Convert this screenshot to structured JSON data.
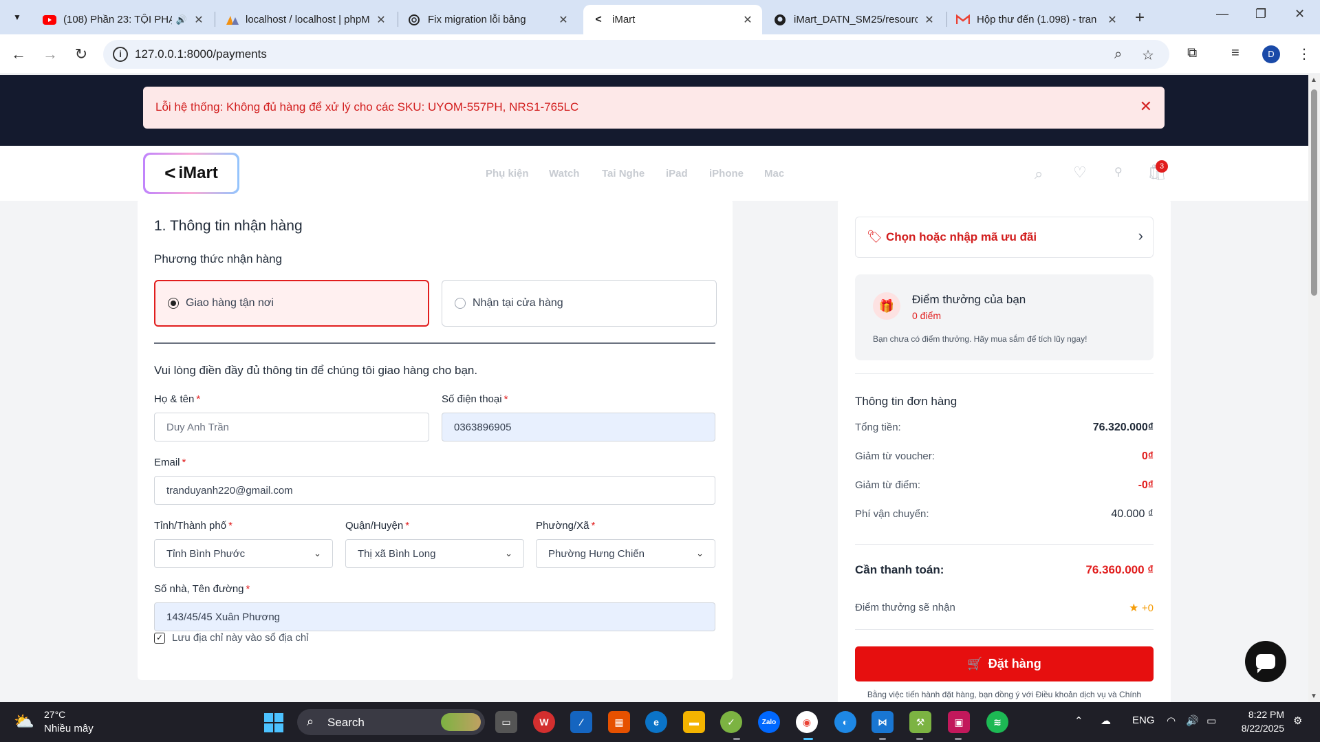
{
  "browser": {
    "tabs": [
      {
        "title": "(108) Phần 23: TỘI PHẠ",
        "icon": "youtube-icon"
      },
      {
        "title": "localhost / localhost | phpM",
        "icon": "phpmyadmin-icon"
      },
      {
        "title": "Fix migration lỗi bảng",
        "icon": "chatgpt-icon"
      },
      {
        "title": "iMart",
        "icon": "imart-icon"
      },
      {
        "title": "iMart_DATN_SM25/resourc",
        "icon": "github-icon"
      },
      {
        "title": "Hộp thư đến (1.098) - tran",
        "icon": "gmail-icon"
      }
    ],
    "url": "127.0.0.1:8000/payments",
    "profile_initial": "D"
  },
  "alert": {
    "message": "Lỗi hệ thống: Không đủ hàng để xử lý cho các SKU: UYOM-557PH, NRS1-765LC"
  },
  "header": {
    "logo_text": "iMart",
    "nav": [
      "Phụ kiện",
      "Watch",
      "Tai Nghe",
      "iPad",
      "iPhone",
      "Mac"
    ],
    "cart_count": "3"
  },
  "shipping": {
    "section_title": "1. Thông tin nhận hàng",
    "method_title": "Phương thức nhận hàng",
    "option_delivery": "Giao hàng tận nơi",
    "option_pickup": "Nhận tại cửa hàng",
    "intro": "Vui lòng điền đầy đủ thông tin để chúng tôi giao hàng cho bạn.",
    "fullname_label": "Họ & tên",
    "fullname_value": "Duy Anh Trần",
    "phone_label": "Số điện thoại",
    "phone_value": "0363896905",
    "email_label": "Email",
    "email_value": "tranduyanh220@gmail.com",
    "province_label": "Tỉnh/Thành phố",
    "province_value": "Tỉnh Bình Phước",
    "district_label": "Quận/Huyện",
    "district_value": "Thị xã Bình Long",
    "ward_label": "Phường/Xã",
    "ward_value": "Phường Hưng Chiến",
    "address_label": "Số nhà, Tên đường",
    "address_value": "143/45/45 Xuân Phương",
    "save_address_label": "Lưu địa chỉ này vào sổ địa chỉ",
    "required_mark": "*",
    "checkmark": "✓"
  },
  "summary": {
    "voucher_label": "Chọn hoặc nhập mã ưu đãi",
    "points_title": "Điểm thưởng của bạn",
    "points_value": "0 điểm",
    "points_note": "Bạn chưa có điểm thưởng. Hãy mua sắm để tích lũy ngay!",
    "order_info_title": "Thông tin đơn hàng",
    "total_label": "Tổng tiền:",
    "total_value": "76.320.000₫",
    "voucher_discount_label": "Giảm từ voucher:",
    "voucher_discount_value": "0₫",
    "points_discount_label": "Giảm từ điểm:",
    "points_discount_value": "-0₫",
    "shipping_fee_label": "Phí vận chuyển:",
    "shipping_fee_value": "40.000 ₫",
    "payable_label": "Cần thanh toán:",
    "payable_value": "76.360.000 ₫",
    "earn_label": "Điểm thưởng sẽ nhận",
    "earn_value": "+0",
    "order_button": "Đặt hàng",
    "terms": "Bằng việc tiến hành đặt hàng, bạn đồng ý với Điều khoản dịch vụ và Chính"
  },
  "taskbar": {
    "temperature": "27°C",
    "weather": "Nhiều mây",
    "search_placeholder": "Search",
    "language": "ENG",
    "time": "8:22 PM",
    "date": "8/22/2025"
  },
  "colors": {
    "accent_red": "#e11d1d",
    "dark_band": "#141a2e",
    "alert_bg": "#fde8e8"
  }
}
